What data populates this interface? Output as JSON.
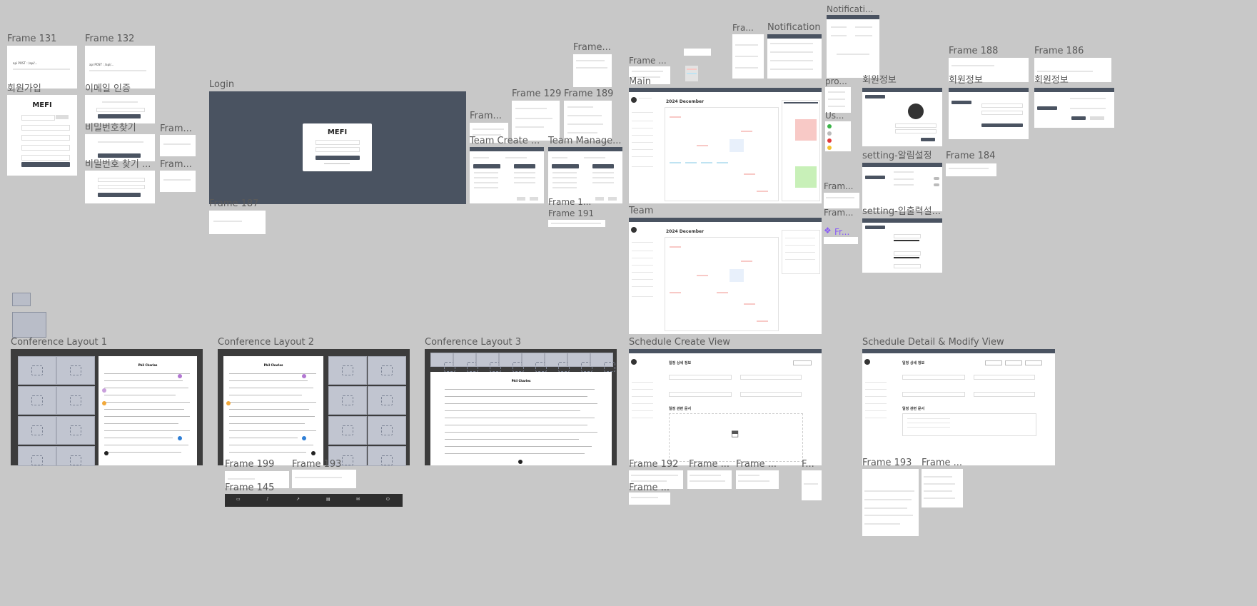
{
  "labels": {
    "f131": "Frame 131",
    "f132": "Frame 132",
    "signup": "회원가입",
    "email_verify": "이메일 인증",
    "find_pw1": "비밀번호찾기",
    "find_pw2": "비밀번호 찾기 ...",
    "frame_a": "Fram...",
    "frame_b": "Fram...",
    "login": "Login",
    "f187": "Frame 187",
    "frame_c": "Frame...",
    "frame_d": "Fram...",
    "f129": "Frame 129",
    "f189": "Frame 189",
    "team_create": "Team Create ...",
    "team_manage": "Team Manage...",
    "f1": "Frame 1...",
    "f191": "Frame 191",
    "frame_e": "Frame ...",
    "main": "Main",
    "team": "Team",
    "fra": "Fra...",
    "notification": "Notification",
    "notificati": "Notificati...",
    "pro": "pro...",
    "us": "Us...",
    "fram2": "Fram...",
    "fram3": "Fram...",
    "fr_comp": "Fr...",
    "f188": "Frame 188",
    "f186": "Frame 186",
    "member_info1": "회원정보",
    "member_info2": "회원정보",
    "member_info3": "회원정보",
    "setting_alarm": "setting-알림설정",
    "f184": "Frame 184",
    "setting_io": "setting-입출력설...",
    "conf1": "Conference Layout 1",
    "conf2": "Conference Layout 2",
    "conf3": "Conference Layout 3",
    "f199": "Frame 199",
    "f193a": "Frame 193",
    "f145": "Frame 145",
    "sched_create": "Schedule Create View",
    "sched_detail": "Schedule Detail & Modify View",
    "f192": "Frame 192",
    "frame_f": "Frame ...",
    "frame_g": "Frame ...",
    "f_h": "F...",
    "frame_i": "Frame ...",
    "f193b": "Frame 193",
    "frame_j": "Frame ..."
  },
  "ui": {
    "mefi1": "MEFI",
    "mefi2": "MEFI",
    "login_btn": "로그인",
    "signup_btn": "회원가입",
    "cal_title1": "2024 December",
    "cal_title2": "2024 December",
    "sched_title1": "일정 상세 정보",
    "sched_title2": "일정 상세 정보",
    "sched_docs1": "일정 관련 문서",
    "sched_docs2": "일정 관련 문서",
    "doc_title1": "Phil Charles",
    "doc_title2": "Phil Charles",
    "doc_title3": "Phil Charles",
    "api_post": "api POST : /api/..."
  },
  "colors": {
    "canvas": "#c8c8c8",
    "header": "#4a5361",
    "conference_bg": "#3c3c3c",
    "tile": "#c1c5d0",
    "event_red": "#f8c9c6",
    "event_green": "#c8f0b8",
    "event_blue": "#bfe3f2",
    "accent_purple": "#8a5cf6"
  }
}
